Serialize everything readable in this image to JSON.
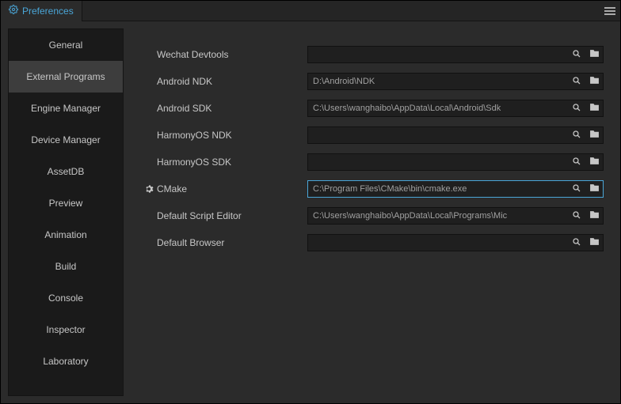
{
  "title": "Preferences",
  "sidebar": {
    "items": [
      {
        "label": "General"
      },
      {
        "label": "External Programs"
      },
      {
        "label": "Engine Manager"
      },
      {
        "label": "Device Manager"
      },
      {
        "label": "AssetDB"
      },
      {
        "label": "Preview"
      },
      {
        "label": "Animation"
      },
      {
        "label": "Build"
      },
      {
        "label": "Console"
      },
      {
        "label": "Inspector"
      },
      {
        "label": "Laboratory"
      }
    ],
    "activeIndex": 1
  },
  "rows": [
    {
      "label": "Wechat Devtools",
      "value": "",
      "gear": false,
      "selected": false
    },
    {
      "label": "Android NDK",
      "value": "D:\\Android\\NDK",
      "gear": false,
      "selected": false
    },
    {
      "label": "Android SDK",
      "value": "C:\\Users\\wanghaibo\\AppData\\Local\\Android\\Sdk",
      "gear": false,
      "selected": false
    },
    {
      "label": "HarmonyOS NDK",
      "value": "",
      "gear": false,
      "selected": false
    },
    {
      "label": "HarmonyOS SDK",
      "value": "",
      "gear": false,
      "selected": false
    },
    {
      "label": "CMake",
      "value": "C:\\Program Files\\CMake\\bin\\cmake.exe",
      "gear": true,
      "selected": true
    },
    {
      "label": "Default Script Editor",
      "value": "C:\\Users\\wanghaibo\\AppData\\Local\\Programs\\Mic",
      "gear": false,
      "selected": false
    },
    {
      "label": "Default Browser",
      "value": "",
      "gear": false,
      "selected": false
    }
  ]
}
